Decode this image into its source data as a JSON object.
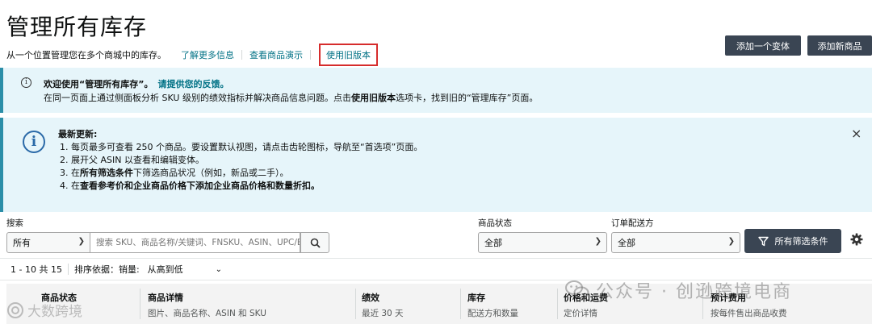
{
  "header": {
    "title": "管理所有库存",
    "description": "从一个位置管理您在多个商城中的库存。",
    "links": [
      "了解更多信息",
      "查看商品演示",
      "使用旧版本"
    ],
    "buttons": {
      "add_variant": "添加一个变体",
      "add_product": "添加新商品"
    }
  },
  "banner_welcome": {
    "title": "欢迎使用“管理所有库存”。",
    "feedback": "请提供您的反馈。",
    "body_pre": "在同一页面上通过侧面板分析 SKU 级别的绩效指标并解决商品信息问题。点击",
    "body_bold": "使用旧版本",
    "body_post": "选项卡，找到旧的“管理库存”页面。"
  },
  "banner_updates": {
    "title": "最新更新:",
    "item1": "1. 每页最多可查看 250 个商品。要设置默认视图，请点击齿轮图标，导航至“首选项”页面。",
    "item2": "2. 展开父 ASIN 以查看和编辑变体。",
    "item3_pre": "3. 在",
    "item3_bold": "所有筛选条件",
    "item3_post": "下筛选商品状况（例如，新品或二手）。",
    "item4_pre": "4. 在",
    "item4_bold": "查看参考价和企业商品价格下添加企业商品价格和数量折扣。",
    "close": "×"
  },
  "filters": {
    "search_label": "搜索",
    "search_scope": "所有",
    "search_placeholder": "搜索 SKU、商品名称/关键词、FNSKU、ASIN、UPC/E",
    "status_label": "商品状态",
    "status_value": "全部",
    "fulfillment_label": "订单配送方",
    "fulfillment_value": "全部",
    "all_filters": "所有筛选条件"
  },
  "results": {
    "count": "1 - 10 共 15",
    "sort_label": "排序依据：销量:",
    "sort_value": "从高到低"
  },
  "table": {
    "columns": [
      {
        "title": "商品状态",
        "sub": ""
      },
      {
        "title": "商品详情",
        "sub": "图片、商品名称、ASIN 和 SKU"
      },
      {
        "title": "绩效",
        "sub": "最近 30 天"
      },
      {
        "title": "库存",
        "sub": "配送方和数量"
      },
      {
        "title": "价格和运费",
        "sub": "定价详情"
      },
      {
        "title": "预计费用",
        "sub": "按每件售出商品收费"
      }
    ]
  },
  "watermark": {
    "right": "公众号 · 创逊跨境电商",
    "left": "大数跨境"
  },
  "colors": {
    "accent_link": "#007185",
    "banner_bg": "#e6f5fa",
    "banner_border": "#2b8ea8",
    "dark_button": "#3a4553",
    "highlight_box": "#d62c2c"
  }
}
